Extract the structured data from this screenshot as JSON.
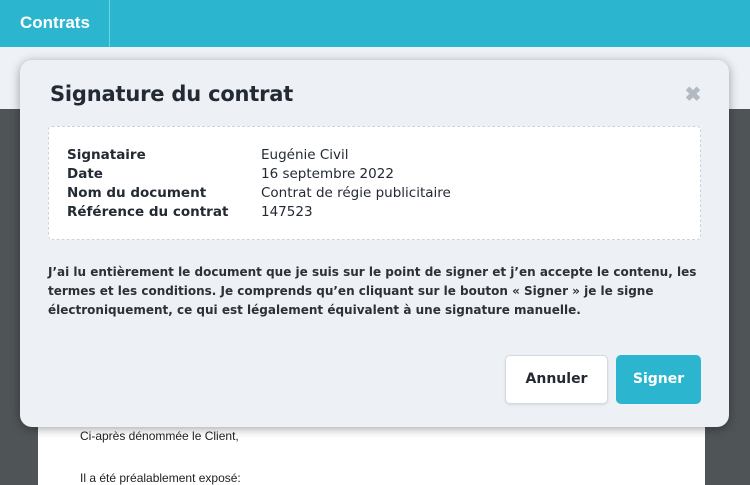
{
  "topbar": {
    "tab_label": "Contrats"
  },
  "document": {
    "line1": "Ci-après dénommée le Client,",
    "line2": "Il a été préalablement exposé:"
  },
  "modal": {
    "title": "Signature du contrat",
    "close_icon": "close-icon",
    "info": [
      {
        "label": "Signataire",
        "value": "Eugénie Civil"
      },
      {
        "label": "Date",
        "value": "16 septembre 2022"
      },
      {
        "label": "Nom du document",
        "value": "Contrat de régie publicitaire"
      },
      {
        "label": "Référence du contrat",
        "value": "147523"
      }
    ],
    "consent_text": "J’ai lu entièrement le document que je suis sur le point de signer et j’en accepte le contenu, les termes et les conditions. Je comprends qu’en cliquant sur le bouton « Signer » je le signe électroniquement, ce qui est légalement équivalent à une signature manuelle.",
    "cancel_label": "Annuler",
    "sign_label": "Signer"
  },
  "colors": {
    "accent": "#2bb5ce",
    "overlay": "#4f5456",
    "modal_bg": "#edf0f5"
  }
}
